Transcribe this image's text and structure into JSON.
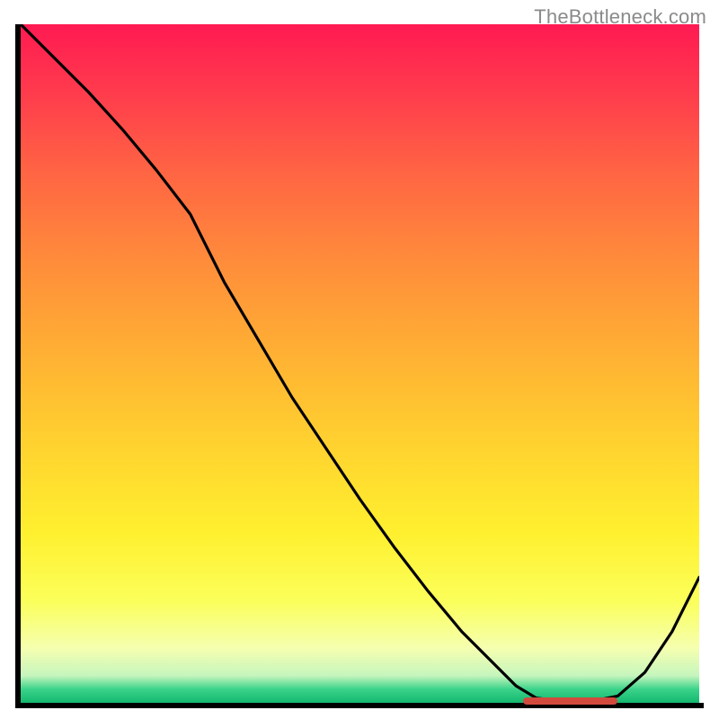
{
  "watermark": "TheBottleneck.com",
  "colors": {
    "axis": "#000000",
    "curve": "#000000",
    "marker": "#d24a3e",
    "gradient_top": "#ff1a52",
    "gradient_bottom": "#14b76f"
  },
  "chart_data": {
    "type": "line",
    "title": "",
    "xlabel": "",
    "ylabel": "",
    "xlim": [
      0,
      100
    ],
    "ylim": [
      0,
      100
    ],
    "grid": false,
    "x": [
      0,
      5,
      10,
      15,
      20,
      25,
      30,
      35,
      40,
      45,
      50,
      55,
      60,
      65,
      70,
      73,
      76,
      80,
      84,
      88,
      92,
      96,
      100
    ],
    "values": [
      100,
      95,
      90,
      84.5,
      78.5,
      72,
      62,
      53.5,
      45,
      37.5,
      30,
      23,
      16.5,
      10.5,
      5.5,
      2.5,
      0.7,
      0.2,
      0.2,
      1.0,
      4.5,
      10.5,
      18.5
    ],
    "marker": {
      "x_start": 74,
      "x_end": 88,
      "y": 0.3,
      "thickness_pct": 1.1
    }
  }
}
